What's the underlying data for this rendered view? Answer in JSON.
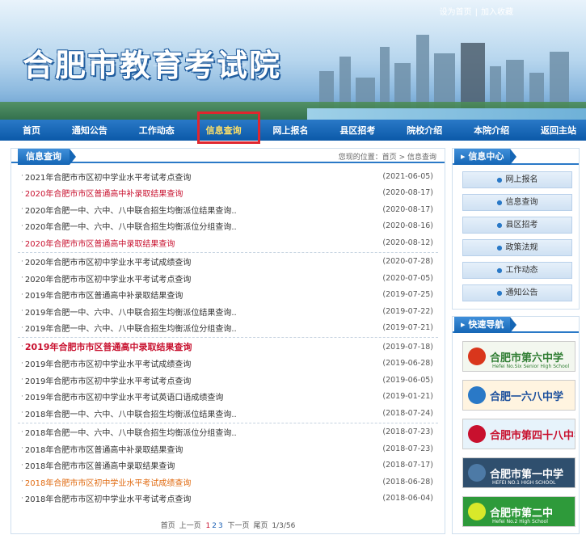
{
  "header": {
    "site_title": "合肥市教育考试院",
    "top_links": {
      "set_home": "设为首页",
      "favorite": "加入收藏",
      "separator": "|"
    }
  },
  "nav": {
    "items": [
      "首页",
      "通知公告",
      "工作动态",
      "信息查询",
      "网上报名",
      "县区招考",
      "院校介绍",
      "本院介绍",
      "返回主站"
    ],
    "active_index": 3
  },
  "main": {
    "section_title": "信息查询",
    "breadcrumb": "您现的位置：首页 > 信息查询",
    "groups": [
      [
        {
          "title": "2021年合肥市市区初中学业水平考试考点查询",
          "date": "(2021-06-05)",
          "style": "normal"
        },
        {
          "title": "2020年合肥市市区普通高中补录取结果查询",
          "date": "(2020-08-17)",
          "style": "red"
        },
        {
          "title": "2020年合肥一中、六中、八中联合招生均衡派位结果查询..",
          "date": "(2020-08-17)",
          "style": "normal"
        },
        {
          "title": "2020年合肥一中、六中、八中联合招生均衡派位分组查询..",
          "date": "(2020-08-16)",
          "style": "normal"
        },
        {
          "title": "2020年合肥市市区普通高中录取结果查询",
          "date": "(2020-08-12)",
          "style": "red"
        }
      ],
      [
        {
          "title": "2020年合肥市市区初中学业水平考试成绩查询",
          "date": "(2020-07-28)",
          "style": "normal"
        },
        {
          "title": "2020年合肥市市区初中学业水平考试考点查询",
          "date": "(2020-07-05)",
          "style": "normal"
        },
        {
          "title": "2019年合肥市市区普通高中补录取结果查询",
          "date": "(2019-07-25)",
          "style": "normal"
        },
        {
          "title": "2019年合肥一中、六中、八中联合招生均衡派位结果查询..",
          "date": "(2019-07-22)",
          "style": "normal"
        },
        {
          "title": "2019年合肥一中、六中、八中联合招生均衡派位分组查询..",
          "date": "(2019-07-21)",
          "style": "normal"
        }
      ],
      [
        {
          "title": "2019年合肥市市区普通高中录取结果查询",
          "date": "(2019-07-18)",
          "style": "red-bold"
        },
        {
          "title": "2019年合肥市市区初中学业水平考试成绩查询",
          "date": "(2019-06-28)",
          "style": "normal"
        },
        {
          "title": "2019年合肥市市区初中学业水平考试考点查询",
          "date": "(2019-06-05)",
          "style": "normal"
        },
        {
          "title": "2019年合肥市市区初中学业水平考试英语口语成绩查询",
          "date": "(2019-01-21)",
          "style": "normal"
        },
        {
          "title": "2018年合肥一中、六中、八中联合招生均衡派位结果查询..",
          "date": "(2018-07-24)",
          "style": "normal"
        }
      ],
      [
        {
          "title": "2018年合肥一中、六中、八中联合招生均衡派位分组查询..",
          "date": "(2018-07-23)",
          "style": "normal"
        },
        {
          "title": "2018年合肥市市区普通高中补录取结果查询",
          "date": "(2018-07-23)",
          "style": "normal"
        },
        {
          "title": "2018年合肥市市区普通高中录取结果查询",
          "date": "(2018-07-17)",
          "style": "normal"
        },
        {
          "title": "2018年合肥市市区初中学业水平考试成绩查询",
          "date": "(2018-06-28)",
          "style": "orange"
        },
        {
          "title": "2018年合肥市市区初中学业水平考试考点查询",
          "date": "(2018-06-04)",
          "style": "normal"
        }
      ]
    ],
    "pager": {
      "first": "首页",
      "prev": "上一页",
      "pages": [
        "1",
        "2",
        "3"
      ],
      "current_page": "1",
      "next": "下一页",
      "last": "尾页",
      "info": "1/3/56"
    }
  },
  "sidebar": {
    "info_center": {
      "title": "信息中心",
      "items": [
        "网上报名",
        "信息查询",
        "县区招考",
        "政策法规",
        "工作动态",
        "通知公告"
      ]
    },
    "quick_nav": {
      "title": "快速导航",
      "logos": [
        {
          "name": "合肥市第六中学",
          "sub": "Hefei No.Six Senior High School",
          "bg": "#f3f7ef",
          "color": "#2f7d32",
          "emblem": "#d9361c"
        },
        {
          "name": "合肥一六八中学",
          "sub": "",
          "bg": "#fff4e0",
          "color": "#1a4e9c",
          "emblem": "#2a79c7"
        },
        {
          "name": "合肥市第四十八中学",
          "sub": "",
          "bg": "#e7f3fb",
          "color": "#c8102e",
          "emblem": "#c8102e"
        },
        {
          "name": "合肥市第一中学",
          "sub": "HEFEI NO.1 HIGH SCHOOL",
          "bg": "#2f4f6e",
          "color": "#ffffff",
          "emblem": "#4d7aa6"
        },
        {
          "name": "合肥市第二中",
          "sub": "Hefei No.2 High School",
          "bg": "#2e9a3a",
          "color": "#ffffff",
          "emblem": "#d9e82a"
        }
      ]
    }
  }
}
